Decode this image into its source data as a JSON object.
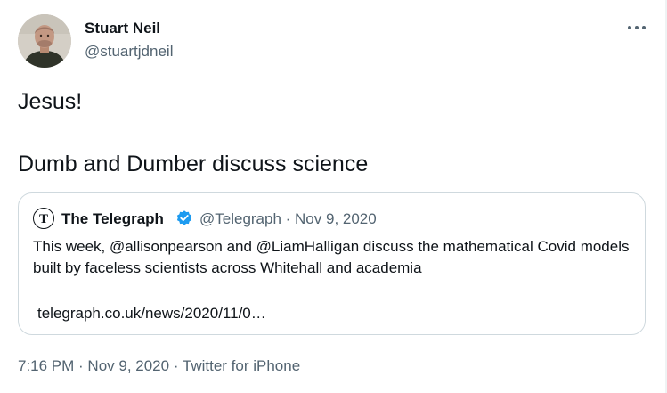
{
  "author": {
    "name": "Stuart Neil",
    "handle": "@stuartjdneil",
    "avatar_icon": "profile-photo"
  },
  "more_icon": "more-horizontal-icon",
  "tweet": {
    "lines": [
      "Jesus!",
      "Dumb and Dumber discuss science"
    ]
  },
  "quoted": {
    "name": "The Telegraph",
    "verified": true,
    "handle": "@Telegraph",
    "date": "Nov 9, 2020",
    "meta": "@Telegraph · Nov 9, 2020",
    "text": "This week, @allisonpearson and @LiamHalligan discuss the mathematical Covid models built by faceless scientists across Whitehall and academia",
    "link": "telegraph.co.uk/news/2020/11/0…",
    "logo_icon": "telegraph-logo-icon",
    "verified_icon": "verified-badge-icon"
  },
  "footer": {
    "time": "7:16 PM",
    "date": "Nov 9, 2020",
    "source": "Twitter for iPhone",
    "text": "7:16 PM · Nov 9, 2020 · Twitter for iPhone"
  },
  "colors": {
    "text": "#0f1419",
    "secondary": "#536471",
    "border": "#cfd9de",
    "verified": "#1d9bf0"
  }
}
